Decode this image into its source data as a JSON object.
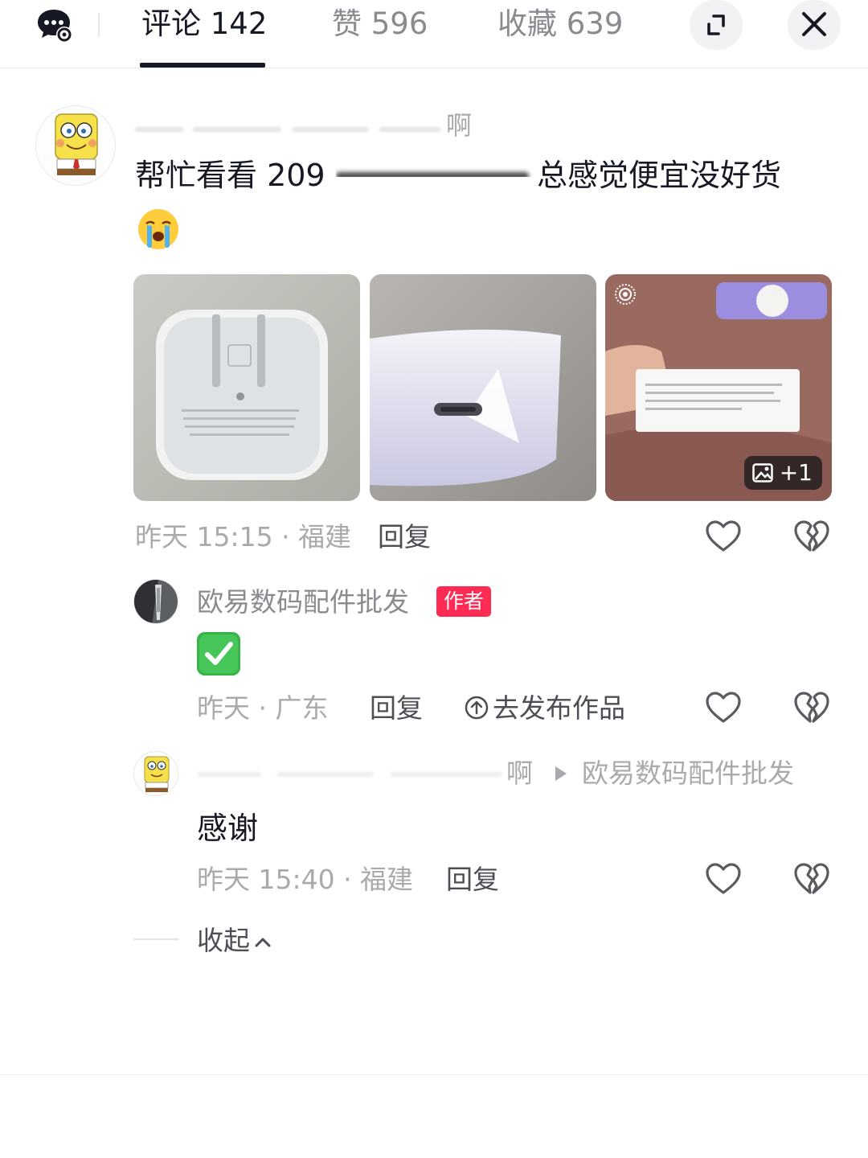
{
  "header": {
    "tabs": [
      {
        "label": "评论 142",
        "active": true
      },
      {
        "label": "赞 596",
        "active": false
      },
      {
        "label": "收藏 639",
        "active": false
      }
    ],
    "icons": {
      "message": "message-settings-icon",
      "expand": "expand-icon",
      "close": "close-icon"
    }
  },
  "comment": {
    "username_visible_tail": "啊",
    "text_start": "帮忙看看 209",
    "text_end": "总感觉便宜没好货",
    "emoji": "crying-face-emoji",
    "images": [
      {
        "name": "charger-prongs-photo"
      },
      {
        "name": "charger-usb-c-port-photo"
      },
      {
        "name": "charger-box-photo",
        "more_count": "+1"
      }
    ],
    "time_location": "昨天 15:15 · 福建",
    "reply_label": "回复",
    "like_icon": "heart-icon",
    "dislike_icon": "broken-heart-icon"
  },
  "replies": [
    {
      "author": "欧易数码配件批发",
      "badge": "作者",
      "emoji": "check-mark-button-emoji",
      "time_location": "昨天 · 广东",
      "reply_label": "回复",
      "publish_label": "去发布作品"
    },
    {
      "author_visible_tail": "啊",
      "reply_to": "欧易数码配件批发",
      "text": "感谢",
      "time_location": "昨天 15:40 · 福建",
      "reply_label": "回复"
    }
  ],
  "collapse_label": "收起",
  "colors": {
    "accent": "#fe2c55",
    "text": "#161823",
    "muted": "#a9aaae",
    "check_green": "#37b54a"
  }
}
